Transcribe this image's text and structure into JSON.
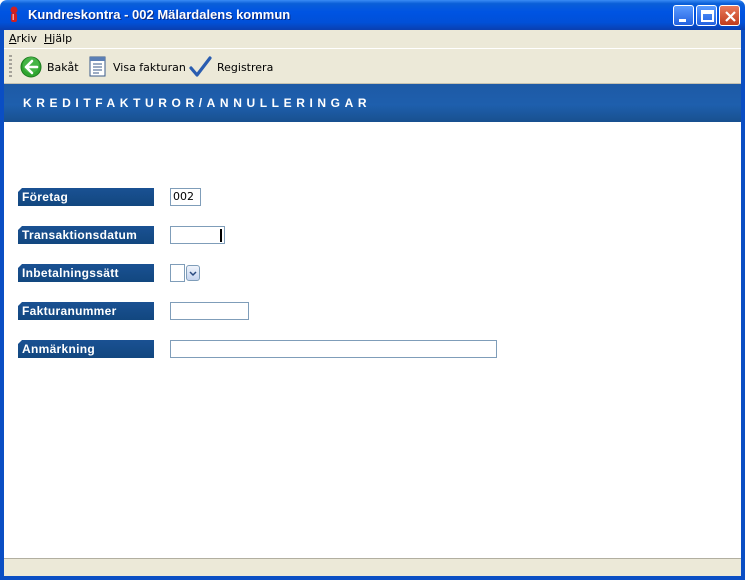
{
  "window": {
    "title": "Kundreskontra  -  002 Mälardalens kommun"
  },
  "menu": {
    "items": [
      {
        "label": "Arkiv",
        "accel": "A",
        "rest": "rkiv"
      },
      {
        "label": "Hjälp",
        "accel": "H",
        "rest": "jälp"
      }
    ]
  },
  "toolbar": {
    "back_label": "Bakåt",
    "view_invoice_label": "Visa fakturan",
    "register_label": "Registrera"
  },
  "header": {
    "title": "KREDITFAKTUROR/ANNULLERINGAR"
  },
  "form": {
    "company_label": "Företag",
    "company_value": "002",
    "transaction_date_label": "Transaktionsdatum",
    "transaction_date_value": "",
    "payment_method_label": "Inbetalningssätt",
    "payment_method_value": "",
    "invoice_number_label": "Fakturanummer",
    "invoice_number_value": "",
    "remark_label": "Anmärkning",
    "remark_value": ""
  },
  "colors": {
    "titlebar": "#0054e3",
    "banner": "#1e5fad",
    "label_bg": "#1a5193",
    "chrome": "#ece9d8"
  }
}
